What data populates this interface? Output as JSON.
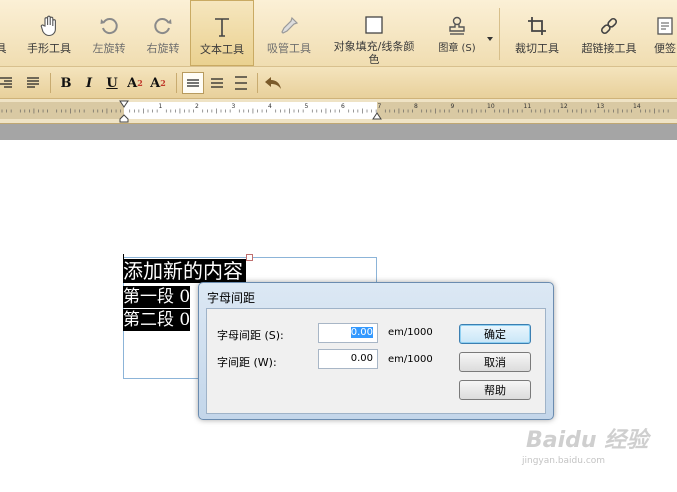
{
  "toolbar": {
    "tools": [
      {
        "label": "具",
        "icon": "tool-icon"
      },
      {
        "label": "手形工具",
        "icon": "hand-icon"
      },
      {
        "label": "左旋转",
        "icon": "rotate-left-icon"
      },
      {
        "label": "右旋转",
        "icon": "rotate-right-icon"
      },
      {
        "label": "文本工具",
        "icon": "text-tool-icon"
      },
      {
        "label": "吸管工具",
        "icon": "eyedropper-icon"
      },
      {
        "label": "对象填充/线条颜",
        "label2": "色",
        "icon": "fill-icon"
      },
      {
        "label": "图章 (S)",
        "icon": "stamp-icon"
      },
      {
        "label": "裁切工具",
        "icon": "crop-icon"
      },
      {
        "label": "超链接工具",
        "icon": "link-icon"
      },
      {
        "label": "便签",
        "icon": "note-icon"
      }
    ]
  },
  "format_bar": {
    "bold": "B",
    "italic": "I",
    "underline": "U",
    "superscript": "A",
    "sup_mark": "2",
    "subscript": "A",
    "sub_mark": "2"
  },
  "ruler": {
    "numbers": [
      "1",
      "2",
      "3",
      "4",
      "5",
      "6",
      "7",
      "8",
      "9",
      "10",
      "11",
      "12",
      "13",
      "14"
    ]
  },
  "document": {
    "lines": [
      "添加新的内容",
      "第一段 0",
      "第二段 0"
    ]
  },
  "dialog": {
    "title": "字母间距",
    "letter_spacing_label": "字母间距 (S):",
    "letter_spacing_value": "0.00",
    "word_spacing_label": "字间距 (W):",
    "word_spacing_value": "0.00",
    "unit": "em/1000",
    "ok_label": "确定",
    "cancel_label": "取消",
    "help_label": "帮助"
  },
  "watermark": {
    "brand": "Baidu 经验",
    "url": "jingyan.baidu.com"
  },
  "colors": {
    "toolbar_bg": "#f0ddb1",
    "dialog_bg": "#c3d6ea",
    "selection": "#000000",
    "input_highlight": "#3399ff"
  }
}
